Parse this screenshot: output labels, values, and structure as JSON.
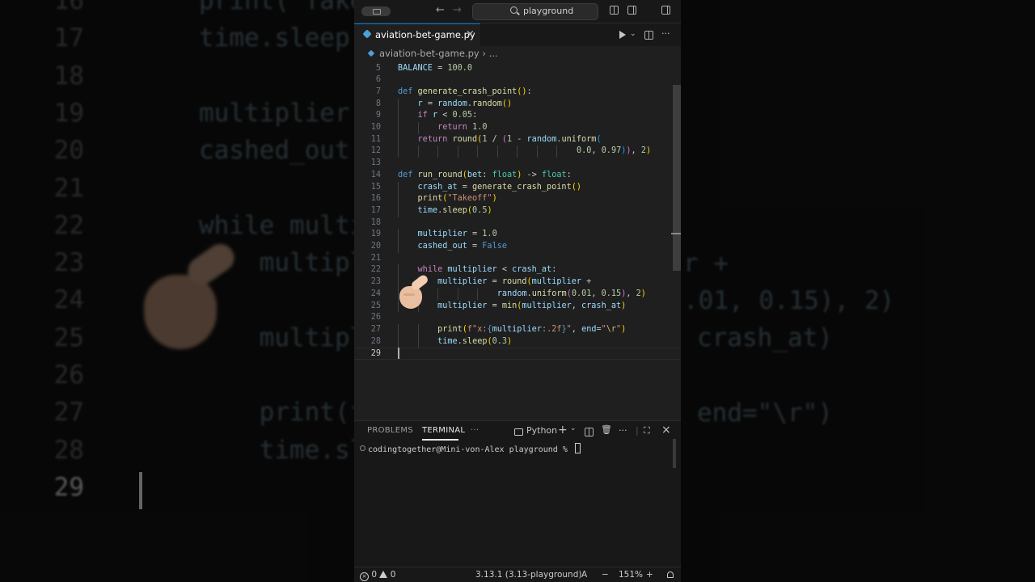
{
  "background": {
    "lines": [
      {
        "num": "16",
        "html": "print(\"Take"
      },
      {
        "num": "17",
        "html": "time.sleep"
      },
      {
        "num": "18",
        "html": ""
      },
      {
        "num": "19",
        "html": "multiplier"
      },
      {
        "num": "20",
        "html": "cashed_out"
      },
      {
        "num": "21",
        "html": ""
      },
      {
        "num": "22",
        "html": "while multi"
      },
      {
        "num": "23",
        "html": "    multipl"
      },
      {
        "num": "24",
        "html": ""
      },
      {
        "num": "25",
        "html": "    multipl"
      },
      {
        "num": "26",
        "html": ""
      },
      {
        "num": "27",
        "html": "    print(f"
      },
      {
        "num": "28",
        "html": "    time.sl"
      },
      {
        "num": "29",
        "html": ""
      }
    ],
    "right_fragments": [
      {
        "text": "r +"
      },
      {
        "text": ".01, 0.15), 2)"
      },
      {
        "text": "crash_at)"
      },
      {
        "text": "end=\"\\r\")"
      }
    ]
  },
  "titlebar": {
    "search_label": "playground",
    "back_icon": "arrow-left-icon",
    "forward_icon": "arrow-right-icon"
  },
  "tab": {
    "filename": "aviation-bet-game.py",
    "close_glyph": "×"
  },
  "breadcrumb": {
    "file": "aviation-bet-game.py",
    "separator": "›",
    "more": "..."
  },
  "editor": {
    "lines": [
      {
        "num": "5",
        "indent": 0,
        "html": "<span class=\"vr\">BALANCE</span> = <span class=\"nm\">100.0</span>"
      },
      {
        "num": "6",
        "indent": 0,
        "html": ""
      },
      {
        "num": "7",
        "indent": 0,
        "html": "<span class=\"df\">def</span> <span class=\"fn\">generate_crash_point</span><span class=\"p1\">()</span>:"
      },
      {
        "num": "8",
        "indent": 1,
        "html": "<span class=\"vr\">r</span> = <span class=\"vr\">random</span>.<span class=\"fn\">random</span><span class=\"p1\">()</span>"
      },
      {
        "num": "9",
        "indent": 1,
        "html": "<span class=\"ctl\">if</span> <span class=\"vr\">r</span> &lt; <span class=\"nm\">0.05</span>:"
      },
      {
        "num": "10",
        "indent": 2,
        "html": "<span class=\"ctl\">return</span> <span class=\"nm\">1.0</span>"
      },
      {
        "num": "11",
        "indent": 1,
        "html": "<span class=\"ctl\">return</span> <span class=\"fn\">round</span><span class=\"p1\">(</span><span class=\"nm\">1</span> / <span class=\"p2\">(</span><span class=\"nm\">1</span> - <span class=\"vr\">random</span>.<span class=\"fn\">uniform</span><span class=\"p3\">(</span>"
      },
      {
        "num": "12",
        "indent": 9,
        "html": "<span class=\"nm\">0.0</span>, <span class=\"nm\">0.97</span><span class=\"p3\">)</span><span class=\"p2\">)</span>, <span class=\"nm\">2</span><span class=\"p1\">)</span>"
      },
      {
        "num": "13",
        "indent": 0,
        "html": ""
      },
      {
        "num": "14",
        "indent": 0,
        "html": "<span class=\"df\">def</span> <span class=\"fn\">run_round</span><span class=\"p1\">(</span><span class=\"vr\">bet</span>: <span class=\"ty\">float</span><span class=\"p1\">)</span> -&gt; <span class=\"ty\">float</span>:"
      },
      {
        "num": "15",
        "indent": 1,
        "html": "<span class=\"vr\">crash_at</span> = <span class=\"fn\">generate_crash_point</span><span class=\"p1\">()</span>"
      },
      {
        "num": "16",
        "indent": 1,
        "html": "<span class=\"fn\">print</span><span class=\"p1\">(</span><span class=\"st\">\"Takeoff\"</span><span class=\"p1\">)</span>"
      },
      {
        "num": "17",
        "indent": 1,
        "html": "<span class=\"vr\">time</span>.<span class=\"fn\">sleep</span><span class=\"p1\">(</span><span class=\"nm\">0.5</span><span class=\"p1\">)</span>"
      },
      {
        "num": "18",
        "indent": 0,
        "html": ""
      },
      {
        "num": "19",
        "indent": 1,
        "html": "<span class=\"vr\">multiplier</span> = <span class=\"nm\">1.0</span>"
      },
      {
        "num": "20",
        "indent": 1,
        "html": "<span class=\"vr\">cashed_out</span> = <span class=\"bo\">False</span>"
      },
      {
        "num": "21",
        "indent": 0,
        "html": ""
      },
      {
        "num": "22",
        "indent": 1,
        "html": "<span class=\"ctl\">while</span> <span class=\"vr\">multiplier</span> &lt; <span class=\"vr\">crash_at</span>:"
      },
      {
        "num": "23",
        "indent": 2,
        "html": "<span class=\"vr\">multiplier</span> = <span class=\"fn\">round</span><span class=\"p1\">(</span><span class=\"vr\">multiplier</span> +"
      },
      {
        "num": "24",
        "indent": 5,
        "html": "<span class=\"vr\">random</span>.<span class=\"fn\">uniform</span><span class=\"p2\">(</span><span class=\"nm\">0.01</span>, <span class=\"nm\">0.15</span><span class=\"p2\">)</span>, <span class=\"nm\">2</span><span class=\"p1\">)</span>"
      },
      {
        "num": "25",
        "indent": 2,
        "html": "<span class=\"vr\">multiplier</span> = <span class=\"fn\">min</span><span class=\"p1\">(</span><span class=\"vr\">multiplier</span>, <span class=\"vr\">crash_at</span><span class=\"p1\">)</span>"
      },
      {
        "num": "26",
        "indent": 0,
        "html": ""
      },
      {
        "num": "27",
        "indent": 2,
        "html": "<span class=\"fn\">print</span><span class=\"p1\">(</span><span class=\"st\">f\"x:</span><span class=\"df\">{</span><span class=\"vr\">multiplier</span><span class=\"st\">:.2f</span><span class=\"df\">}</span><span class=\"st\">\"</span>, <span class=\"vr\">end</span>=<span class=\"st\">\"</span><span class=\"esc\">\\r</span><span class=\"st\">\"</span><span class=\"p1\">)</span>"
      },
      {
        "num": "28",
        "indent": 2,
        "html": "<span class=\"vr\">time</span>.<span class=\"fn\">sleep</span><span class=\"p1\">(</span><span class=\"nm\">0.3</span><span class=\"p1\">)</span>"
      },
      {
        "num": "29",
        "indent": 0,
        "html": ""
      }
    ],
    "current_line": "29"
  },
  "panel": {
    "tabs": [
      "PROBLEMS",
      "TERMINAL",
      "···"
    ],
    "active_tab": "TERMINAL",
    "shell_label": "Python",
    "add_glyph": "+",
    "chevron_glyph": "⌄",
    "more_glyph": "···",
    "maximize_glyph": "⛶",
    "close_glyph": "×",
    "prompt": "codingtogether@Mini-von-Alex playground % "
  },
  "statusbar": {
    "errors": "0",
    "warnings": "0",
    "interpreter": "3.13.1 (3.13-playground)",
    "zoom_out": "−",
    "zoom_in": "+",
    "zoom": "151%"
  }
}
